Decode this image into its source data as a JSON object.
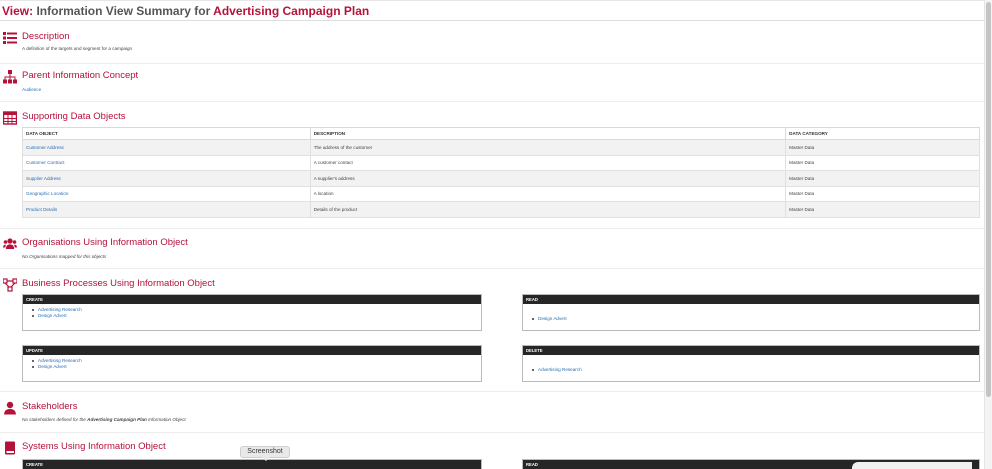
{
  "header": {
    "prefix": "View:",
    "middle": " Information View Summary for ",
    "subject": "Advertising Campaign Plan"
  },
  "description": {
    "title": "Description",
    "text": "A definition of the targets and segment for a campaign"
  },
  "parent": {
    "title": "Parent Information Concept",
    "link": "Audience"
  },
  "supporting": {
    "title": "Supporting Data Objects",
    "columns": [
      "DATA OBJECT",
      "DESCRIPTION",
      "DATA CATEGORY"
    ],
    "rows": [
      [
        "Customer Address",
        "The address of the customer",
        "Master Data"
      ],
      [
        "Customer Contract",
        "A customer contact",
        "Master Data"
      ],
      [
        "Supplier Address",
        "A supplier's address",
        "Master Data"
      ],
      [
        "Geographic Location",
        "A location",
        "Master Data"
      ],
      [
        "Product Details",
        "Details of the product",
        "Master Data"
      ]
    ]
  },
  "organisations": {
    "title": "Organisations Using Information Object",
    "text": "No Organisations mapped for this objects"
  },
  "processes": {
    "title": "Business Processes Using Information Object",
    "create": {
      "label": "CREATE",
      "items": [
        "Advertising Research",
        "Design Advert"
      ]
    },
    "read": {
      "label": "READ",
      "items": [
        "Design Advert"
      ]
    },
    "update": {
      "label": "UPDATE",
      "items": [
        "Advertising Research",
        "Design Advert"
      ]
    },
    "delete": {
      "label": "DELETE",
      "items": [
        "Advertising Research"
      ]
    }
  },
  "stakeholders": {
    "title": "Stakeholders",
    "text_before": "No stakeholders defined for the ",
    "text_bold": "Advertising Campaign Plan",
    "text_after": " Information Object"
  },
  "systems": {
    "title": "Systems Using Information Object",
    "create_label": "CREATE",
    "read_label": "READ"
  },
  "tooltip": {
    "text": "Screenshot"
  },
  "colors": {
    "accent": "#b5123a",
    "link": "#2a6db5",
    "box_header": "#262626"
  },
  "icons": {
    "description": "list-icon",
    "parent": "sitemap-icon",
    "supporting": "table-icon",
    "organisations": "users-icon",
    "processes": "process-icon",
    "stakeholders": "user-icon",
    "systems": "book-icon"
  }
}
